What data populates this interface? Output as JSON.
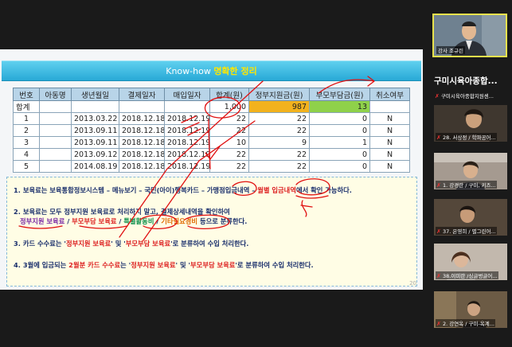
{
  "slide": {
    "title_prefix": "Know-how ",
    "title_highlight": "명확한 정리",
    "page_number": "20",
    "table": {
      "headers": [
        "번호",
        "아동명",
        "생년월일",
        "결제일자",
        "매입일자",
        "합계(원)",
        "정부지원금(원)",
        "부모부담금(원)",
        "취소여부"
      ],
      "total_row": {
        "label": "합계",
        "sum": "1,000",
        "gov": "987",
        "parent": "13"
      },
      "rows": [
        {
          "no": "1",
          "child": "",
          "birth": "2013.03.22",
          "paid": "2018.12.18",
          "bought": "2018.12.19",
          "sum": "22",
          "gov": "22",
          "parent": "0",
          "cancel": "N"
        },
        {
          "no": "2",
          "child": "",
          "birth": "2013.09.11",
          "paid": "2018.12.18",
          "bought": "2018.12.19",
          "sum": "22",
          "gov": "22",
          "parent": "0",
          "cancel": "N"
        },
        {
          "no": "3",
          "child": "",
          "birth": "2013.09.11",
          "paid": "2018.12.18",
          "bought": "2018.12.19",
          "sum": "10",
          "gov": "9",
          "parent": "1",
          "cancel": "N"
        },
        {
          "no": "4",
          "child": "",
          "birth": "2013.09.12",
          "paid": "2018.12.18",
          "bought": "2018.12.19",
          "sum": "22",
          "gov": "22",
          "parent": "0",
          "cancel": "N"
        },
        {
          "no": "5",
          "child": "",
          "birth": "2014.08.19",
          "paid": "2018.12.18",
          "bought": "2018.12.19",
          "sum": "22",
          "gov": "22",
          "parent": "0",
          "cancel": "N"
        }
      ]
    },
    "notes": {
      "n1_a": "1. 보육료는 보육통합정보시스템 – 메뉴보기 – 국민(아이)행복카드 – 가맹점입금내역 – ",
      "n1_b": "월별 입금내역",
      "n1_c": "에서 확인 가능하다.",
      "n2_a": "2. 보육료는 모두 정부지원 보육료로 처리하지 말고, 결제상세내역을 확인하여",
      "n2_t1": "정부지원 보육료",
      "n2_s1": " / ",
      "n2_t2": "부모부담 보육료",
      "n2_s2": " / ",
      "n2_t3": "특별활동비",
      "n2_s3": " / ",
      "n2_t4": "기타필요경비",
      "n2_end": " 등으로 분류한다.",
      "n3_a": "3. 카드 수수료는 '",
      "n3_t1": "정부지원 보육료",
      "n3_m": "' 및 '",
      "n3_t2": "부모부담 보육료",
      "n3_end": "'로 분류하여 수입 처리한다.",
      "n4_a": "4. 3월에 입금되는 ",
      "n4_t0": "2월분 카드 수수료",
      "n4_b": "는 '",
      "n4_t1": "정부지원 보육료",
      "n4_m": "' 및 '",
      "n4_t2": "부모부담 보육료",
      "n4_end": "'로 분류하여 수입 처리한다."
    }
  },
  "sidebar": {
    "presenter_label": "강사 조규린",
    "room_title": "구미시육아종합...",
    "first_participant": "구미시육아종합지원센...",
    "participants": [
      "28. 서상정 / 학파공어...",
      "1. 강경란 / 구미, 키즈...",
      "37. 은영희 / 별그린어...",
      "38.이미란 /싱글벙글어...",
      "2. 강연옥 / 구미-옥계..."
    ]
  },
  "colors": {
    "header_blue": "#28a9d6",
    "gold": "#f2b21d",
    "green": "#8fd14a",
    "ink_red": "#e01010",
    "presenter_border": "#e8e24c"
  }
}
